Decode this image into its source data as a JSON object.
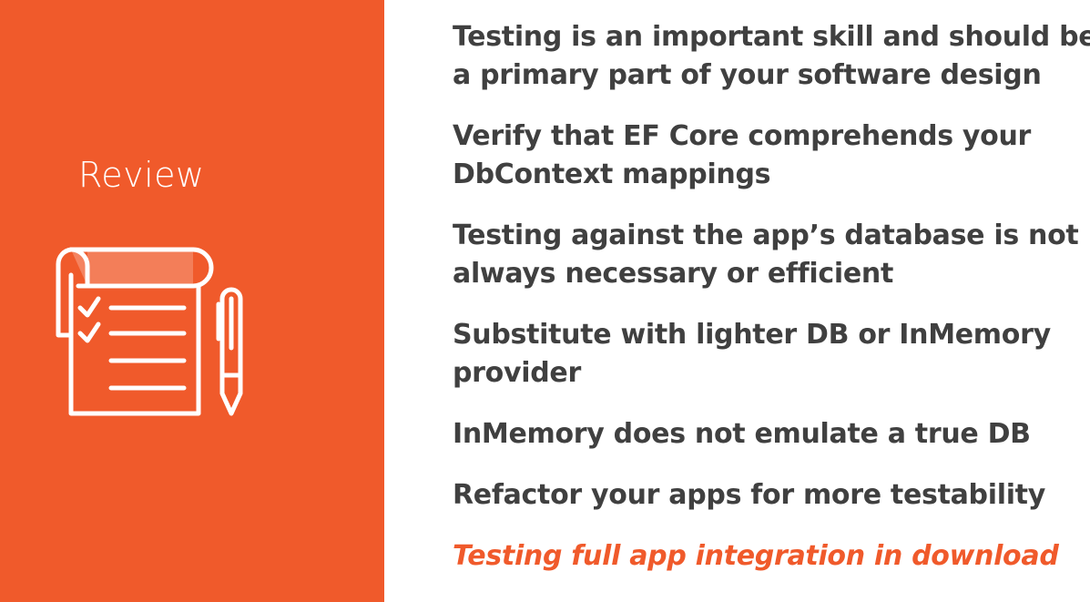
{
  "sidebar": {
    "title": "Review",
    "icon": "checklist-notepad-and-pen-icon",
    "background_color": "#f05a2b"
  },
  "bullets": [
    {
      "line1": "Testing is an important skill and should be",
      "line2": "a primary part of your software design"
    },
    {
      "line1": "Verify that EF Core comprehends your",
      "line2": "DbContext mappings"
    },
    {
      "line1": "Testing against the app’s database is not",
      "line2": "always necessary or efficient"
    },
    {
      "line1": "Substitute with lighter DB or InMemory",
      "line2": "provider"
    },
    {
      "line1": "InMemory does not emulate a true DB"
    },
    {
      "line1": "Refactor your apps for more testability"
    }
  ],
  "highlight": {
    "text": "Testing full app integration in download",
    "color": "#f05a2b"
  },
  "colors": {
    "body_text": "#404040",
    "accent": "#f05a2b"
  }
}
